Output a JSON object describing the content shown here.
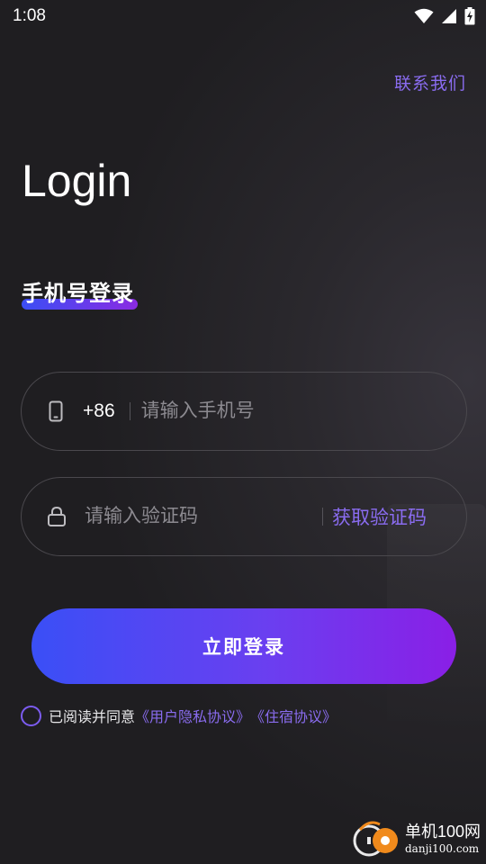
{
  "status_bar": {
    "time": "1:08",
    "icons": [
      "wifi-icon",
      "cellular-signal-icon",
      "battery-charging-icon"
    ]
  },
  "header": {
    "contact_link": "联系我们"
  },
  "page": {
    "title": "Login",
    "tab_label": "手机号登录"
  },
  "phone_field": {
    "icon": "phone-icon",
    "country_code": "+86",
    "value": "",
    "placeholder": "请输入手机号"
  },
  "code_field": {
    "icon": "lock-icon",
    "value": "",
    "placeholder": "请输入验证码",
    "get_code_label": "获取验证码"
  },
  "login_button": {
    "label": "立即登录"
  },
  "agreement": {
    "checked": false,
    "text": "已阅读并同意",
    "privacy_link": "《用户隐私协议》",
    "stay_link": "《住宿协议》"
  },
  "watermark": {
    "name": "单机100网",
    "url": "danji100.com"
  },
  "colors": {
    "background": "#1f1e21",
    "accent": "#8a6cf0",
    "gradient_start": "#3a4ff6",
    "gradient_end": "#8a1fe6",
    "field_border": "#4a484d",
    "placeholder": "#8c8a90"
  }
}
